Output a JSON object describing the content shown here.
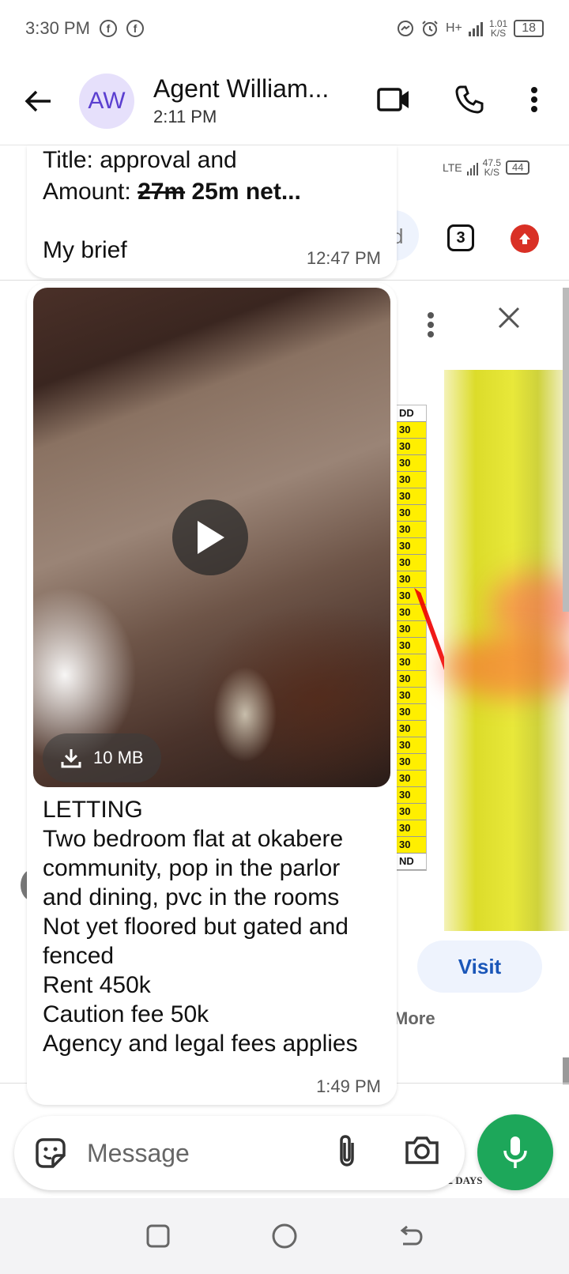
{
  "status_bar": {
    "time": "3:30 PM",
    "notif_icons": [
      "facebook-icon",
      "facebook-icon"
    ],
    "net_speed": "1.01",
    "speed_unit": "K/S",
    "network": "H+",
    "battery": "18"
  },
  "header": {
    "avatar_initials": "AW",
    "contact_name": "Agent William...",
    "last_seen": "2:11 PM"
  },
  "background_app": {
    "status_network": "LTE",
    "status_speed": "47.5",
    "status_speed_unit": "K/S",
    "status_battery": "44",
    "partial_text": "d",
    "badge_count": "3",
    "table_header": "DD",
    "table_values": [
      "30",
      "30",
      "30",
      "30",
      "30",
      "30",
      "30",
      "30",
      "30",
      "30",
      "30",
      "30",
      "30",
      "30",
      "30",
      "30",
      "30",
      "30",
      "30",
      "30",
      "30",
      "30",
      "30",
      "30",
      "30",
      "30",
      "30"
    ],
    "table_footer": "ND",
    "visit_label": "Visit",
    "more_label": "More",
    "bottom_text": "22 DAYS"
  },
  "messages": {
    "m1": {
      "line1": "Title: approval and",
      "line2_prefix": "Amount: ",
      "line2_strike": "27m",
      "line2_bold": " 25m net...",
      "body": "My brief",
      "time": "12:47 PM"
    },
    "m2": {
      "download_size": "10 MB",
      "caption_lines": [
        "LETTING",
        "Two bedroom flat at okabere",
        "community, pop in the parlor",
        "and dining, pvc in the rooms",
        "Not yet floored but gated and",
        "fenced",
        "Rent 450k",
        "Caution fee 50k",
        "Agency and legal fees applies"
      ],
      "time": "1:49 PM"
    }
  },
  "composer": {
    "placeholder": "Message"
  },
  "colors": {
    "accent_green": "#1da75a",
    "avatar_bg": "#e6e0fb",
    "avatar_fg": "#5b3fd0",
    "link_blue": "#1a56b8"
  }
}
